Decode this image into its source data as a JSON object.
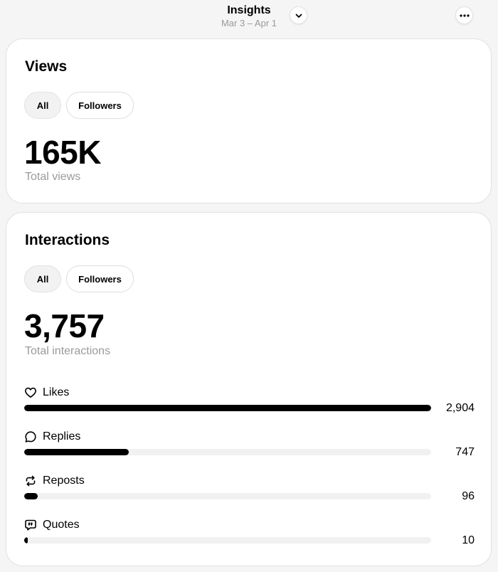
{
  "header": {
    "title": "Insights",
    "date_range": "Mar 3 – Apr 1",
    "dropdown_icon": "chevron-down-icon",
    "more_icon": "more-horizontal-icon"
  },
  "views": {
    "title": "Views",
    "filters": [
      {
        "label": "All",
        "selected": true
      },
      {
        "label": "Followers",
        "selected": false
      }
    ],
    "total": "165K",
    "total_label": "Total views"
  },
  "interactions": {
    "title": "Interactions",
    "filters": [
      {
        "label": "All",
        "selected": true
      },
      {
        "label": "Followers",
        "selected": false
      }
    ],
    "total": "3,757",
    "total_label": "Total interactions",
    "metrics": [
      {
        "label": "Likes",
        "value": "2,904",
        "fraction": 1.0,
        "icon": "heart-icon"
      },
      {
        "label": "Replies",
        "value": "747",
        "fraction": 0.257,
        "icon": "reply-icon"
      },
      {
        "label": "Reposts",
        "value": "96",
        "fraction": 0.033,
        "icon": "repost-icon"
      },
      {
        "label": "Quotes",
        "value": "10",
        "fraction": 0.0034,
        "icon": "quote-icon"
      }
    ]
  },
  "colors": {
    "bar_fill": "#000000",
    "bar_track": "#f1f1f1",
    "muted_text": "#9a9a9a",
    "background": "#f5f5f5"
  }
}
